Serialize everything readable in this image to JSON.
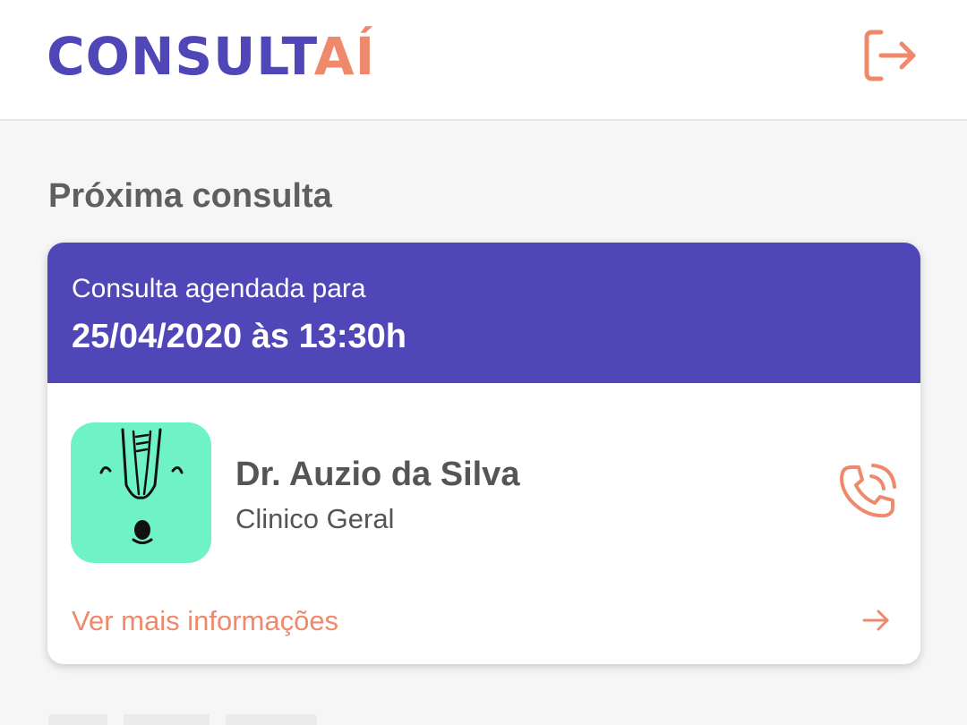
{
  "header": {
    "logo_part1": "CONSULT",
    "logo_part2": "AÍ",
    "logout_icon": "logout-icon"
  },
  "colors": {
    "primary": "#4f46b8",
    "accent": "#ee8a6b",
    "avatar_bg": "#6ef2c6",
    "text_dark": "#555555"
  },
  "next_appointment": {
    "section_title": "Próxima consulta",
    "subtitle": "Consulta agendada para",
    "datetime": "25/04/2020 às 13:30h",
    "doctor": {
      "name": "Dr. Auzio da Silva",
      "specialty": "Clinico Geral",
      "avatar_icon": "doctor-avatar-illustration"
    },
    "call_icon": "phone-call-icon",
    "more_info_label": "Ver mais informações",
    "more_info_icon": "arrow-right-icon"
  }
}
